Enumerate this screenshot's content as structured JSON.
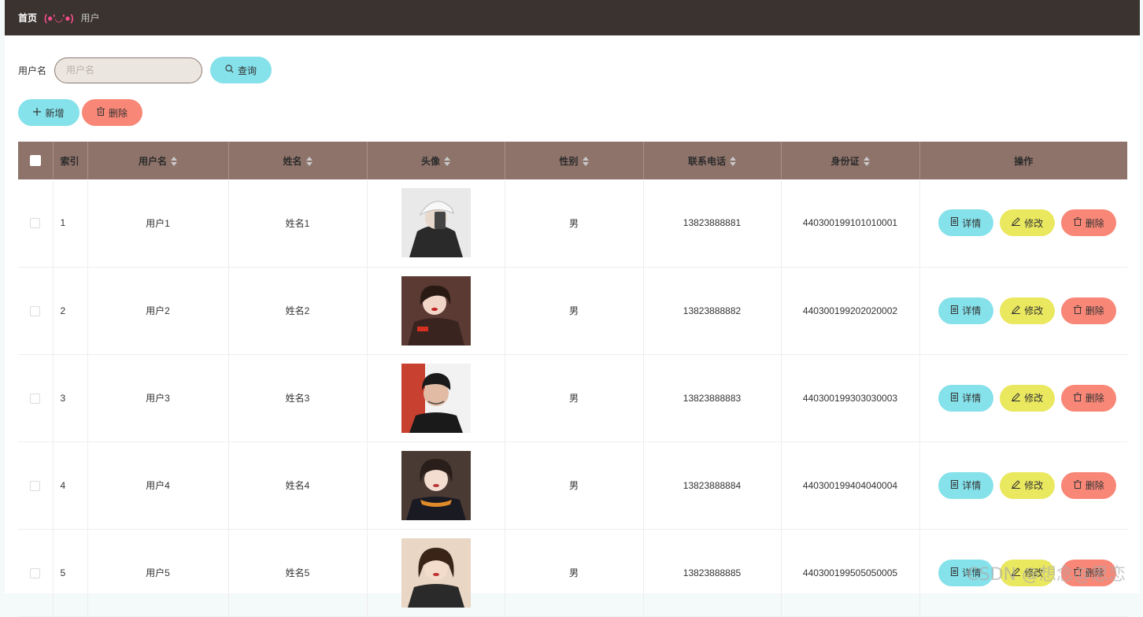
{
  "breadcrumb": {
    "home": "首页",
    "kaomoji": "(●'◡'●)",
    "current": "用户"
  },
  "search": {
    "label": "用户名",
    "placeholder": "用户名",
    "button": "查询"
  },
  "actions": {
    "add": "新增",
    "delete": "删除"
  },
  "table": {
    "headers": {
      "index": "索引",
      "username": "用户名",
      "name": "姓名",
      "avatar": "头像",
      "gender": "性别",
      "phone": "联系电话",
      "idcard": "身份证",
      "ops": "操作"
    },
    "rows": [
      {
        "index": "1",
        "username": "用户1",
        "name": "姓名1",
        "gender": "男",
        "phone": "13823888881",
        "idcard": "440300199101010001"
      },
      {
        "index": "2",
        "username": "用户2",
        "name": "姓名2",
        "gender": "男",
        "phone": "13823888882",
        "idcard": "440300199202020002"
      },
      {
        "index": "3",
        "username": "用户3",
        "name": "姓名3",
        "gender": "男",
        "phone": "13823888883",
        "idcard": "440300199303030003"
      },
      {
        "index": "4",
        "username": "用户4",
        "name": "姓名4",
        "gender": "男",
        "phone": "13823888884",
        "idcard": "440300199404040004"
      },
      {
        "index": "5",
        "username": "用户5",
        "name": "姓名5",
        "gender": "男",
        "phone": "13823888885",
        "idcard": "440300199505050005"
      }
    ],
    "row_buttons": {
      "detail": "详情",
      "edit": "修改",
      "delete": "删除"
    }
  },
  "watermark": "CSDN @想念@思恋",
  "colors": {
    "topbar": "#3a3330",
    "header": "#8e736a",
    "cyan": "#85e1ea",
    "red": "#f88777",
    "yellow": "#eae85f"
  }
}
